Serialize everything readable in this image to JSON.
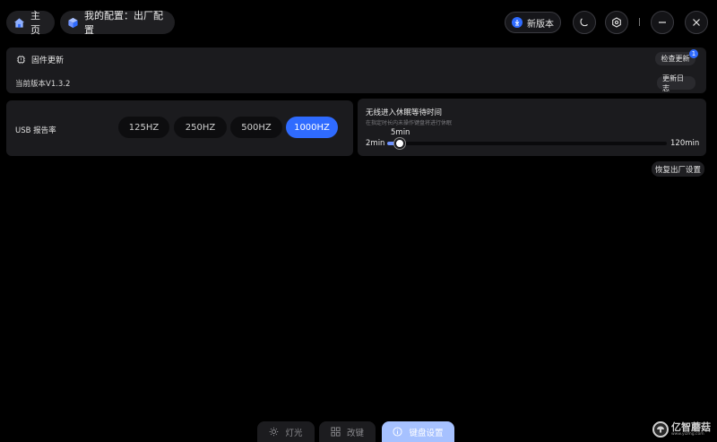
{
  "header": {
    "home_label": "主页",
    "config_label": "我的配置：出厂配置",
    "new_version_label": "新版本"
  },
  "firmware": {
    "title": "固件更新",
    "current_version": "当前版本V1.3.2",
    "check_update_label": "检查更新",
    "update_badge": "1",
    "changelog_label": "更新日志"
  },
  "usb": {
    "label": "USB 报告率",
    "options": [
      "125HZ",
      "250HZ",
      "500HZ",
      "1000HZ"
    ],
    "selected": "1000HZ"
  },
  "sleep": {
    "title": "无线进入休眠等待时间",
    "subtitle": "在指定时长内未操作键盘将进行休眠",
    "value_label": "5min",
    "min_label": "2min",
    "max_label": "120min",
    "min": 2,
    "max": 120,
    "value": 5
  },
  "restore_label": "恢复出厂设置",
  "nav": {
    "items": [
      {
        "label": "灯光",
        "icon": "sun-icon"
      },
      {
        "label": "改键",
        "icon": "grid-icon"
      },
      {
        "label": "键盘设置",
        "icon": "info-icon"
      }
    ],
    "active": "键盘设置"
  },
  "watermark": {
    "main": "亿智蘑菇",
    "sub": "www.yizmg.com"
  },
  "colors": {
    "accent": "#2f6bff",
    "accent_light": "#a6c1ff",
    "panel": "#1b1b1e",
    "background": "#000000"
  }
}
